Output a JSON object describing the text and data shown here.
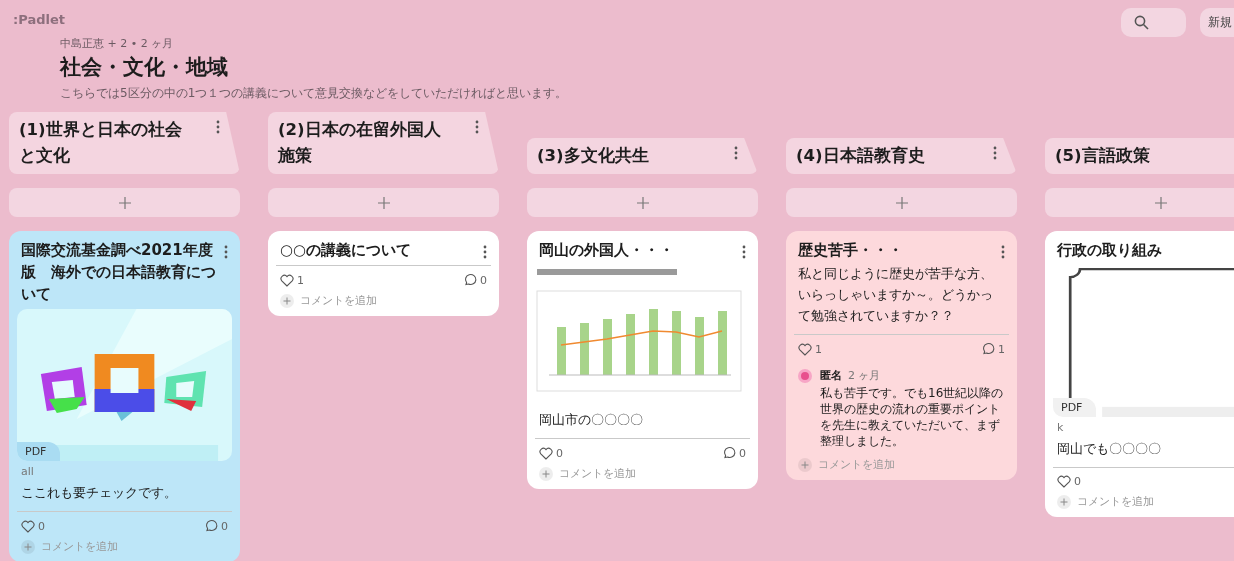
{
  "app": {
    "logo": ":Padlet",
    "new_button": "新規"
  },
  "header": {
    "meta": "中島正恵 + 2 •  2 ヶ月",
    "title": "社会・文化・地域",
    "description": "こちらでは5区分の中の1つ１つの講義について意見交換などをしていただければと思います。"
  },
  "columns": [
    {
      "title": "(1)世界と日本の社会と文化",
      "cards": [
        {
          "color": "#bde6f8",
          "title": "国際交流基金調べ2021年度版　海外での日本語教育について",
          "attachment": {
            "kind": "logos",
            "badge": "PDF"
          },
          "source": "all",
          "body": "ここれも要チェックです。",
          "likes": "0",
          "comment_count": "0",
          "add_comment": "コメントを追加"
        }
      ]
    },
    {
      "title": "(2)日本の在留外国人施策",
      "cards": [
        {
          "color": "#ffffff",
          "title": "○○の講義について",
          "likes": "1",
          "comment_count": "0",
          "add_comment": "コメントを追加"
        }
      ]
    },
    {
      "title": "(3)多文化共生",
      "cards": [
        {
          "color": "#ffffff",
          "title": "岡山の外国人・・・",
          "attachment": {
            "kind": "chart"
          },
          "body": "岡山市の〇〇〇〇",
          "likes": "0",
          "comment_count": "0",
          "add_comment": "コメントを追加"
        }
      ]
    },
    {
      "title": "(4)日本語教育史",
      "cards": [
        {
          "color": "#fdd9dc",
          "title": "歴史苦手・・・",
          "body": "私と同じように歴史が苦手な方、いらっしゃいますか～。どうかって勉強されていますか？？",
          "likes": "1",
          "comment_count": "1",
          "comments": [
            {
              "author": "匿名",
              "time": "2 ヶ月",
              "text": "私も苦手です。でも16世紀以降の世界の歴史の流れの重要ポイントを先生に教えていただいて、まず整理しました。"
            }
          ],
          "add_comment": "コメントを追加"
        }
      ]
    },
    {
      "title": "(5)言語政策",
      "cards": [
        {
          "color": "#ffffff",
          "title": "行政の取り組み",
          "attachment": {
            "kind": "document",
            "badge": "PDF"
          },
          "source": "k",
          "body": "岡山でも〇〇〇〇",
          "likes": "0",
          "add_comment": "コメントを追加"
        }
      ]
    }
  ]
}
